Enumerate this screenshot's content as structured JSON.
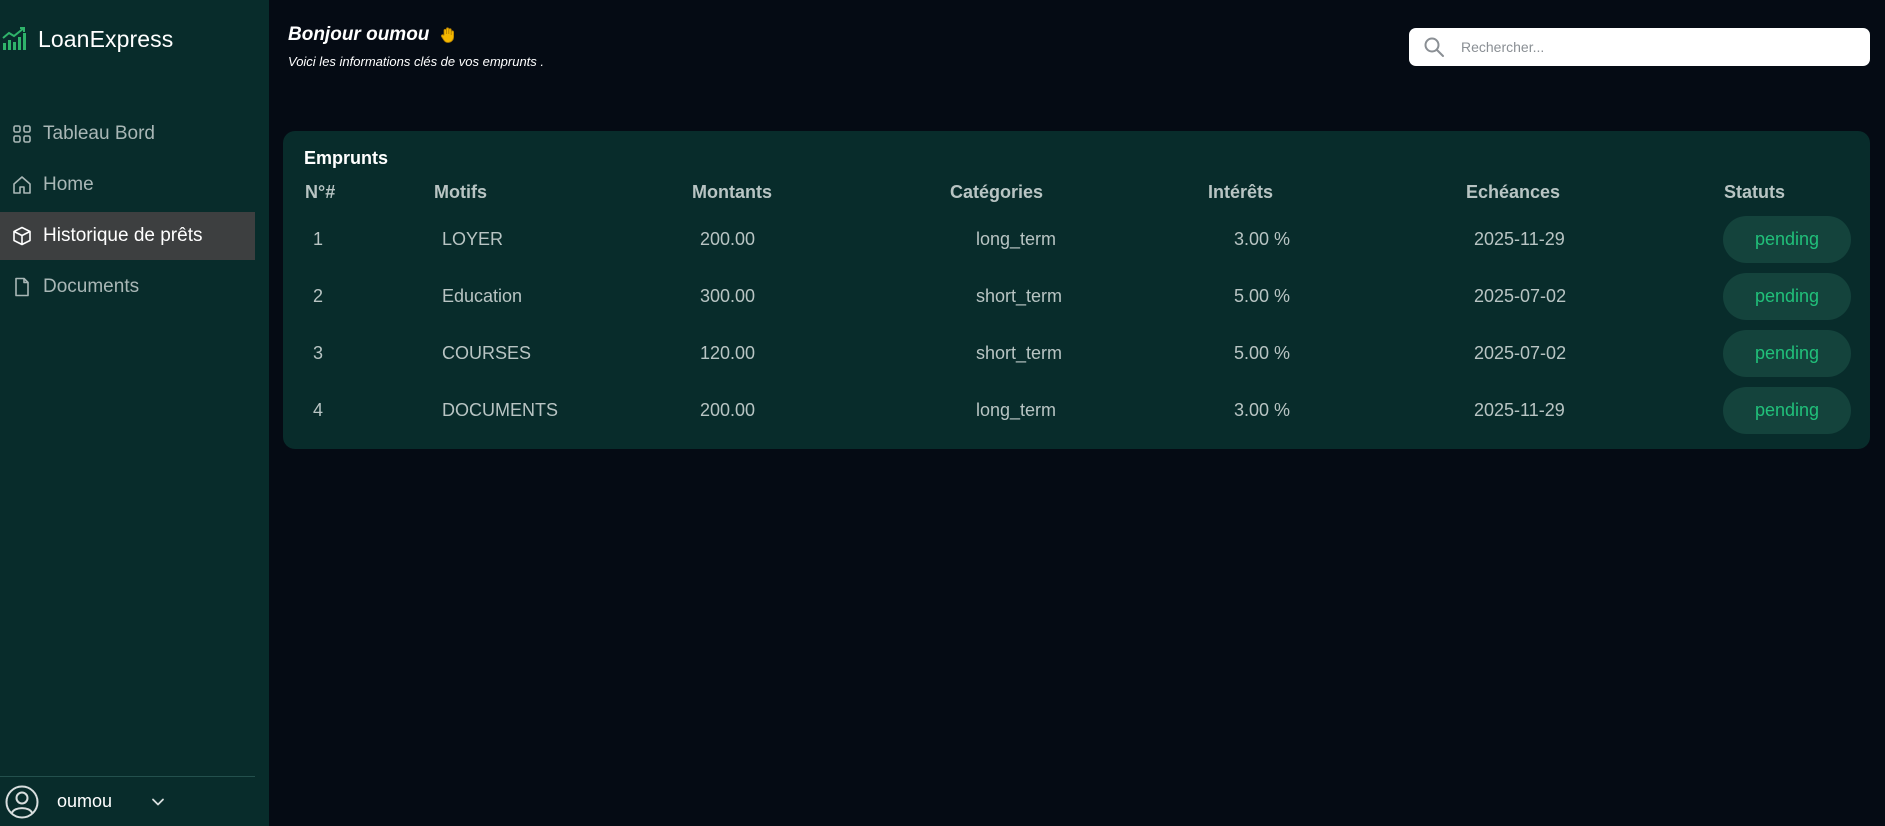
{
  "app": {
    "name": "LoanExpress"
  },
  "sidebar": {
    "items": [
      {
        "label": "Tableau Bord",
        "icon": "grid-icon"
      },
      {
        "label": "Home",
        "icon": "home-icon"
      },
      {
        "label": "Historique de prêts",
        "icon": "box-icon",
        "active": true
      },
      {
        "label": "Documents",
        "icon": "document-icon"
      }
    ],
    "user": {
      "name": "oumou"
    }
  },
  "header": {
    "greeting": "Bonjour oumou",
    "subtitle": "Voici les informations clés de vos emprunts ."
  },
  "search": {
    "placeholder": "Rechercher..."
  },
  "loans": {
    "title": "Emprunts",
    "columns": [
      "N°#",
      "Motifs",
      "Montants",
      "Catégories",
      "Intérêts",
      "Echéances",
      "Statuts"
    ],
    "rows": [
      {
        "num": "1",
        "motif": "LOYER",
        "montant": "200.00",
        "categorie": "long_term",
        "interet": "3.00 %",
        "echeance": "2025-11-29",
        "statut": "pending"
      },
      {
        "num": "2",
        "motif": "Education",
        "montant": "300.00",
        "categorie": "short_term",
        "interet": "5.00 %",
        "echeance": "2025-07-02",
        "statut": "pending"
      },
      {
        "num": "3",
        "motif": "COURSES",
        "montant": "120.00",
        "categorie": "short_term",
        "interet": "5.00 %",
        "echeance": "2025-07-02",
        "statut": "pending"
      },
      {
        "num": "4",
        "motif": "DOCUMENTS",
        "montant": "200.00",
        "categorie": "long_term",
        "interet": "3.00 %",
        "echeance": "2025-11-29",
        "statut": "pending"
      }
    ]
  },
  "colors": {
    "sidebar_bg": "#082c2b",
    "page_bg": "#050b14",
    "active_item": "#3d3f40",
    "status_text": "#21c07a",
    "status_bg": "#14433c"
  }
}
